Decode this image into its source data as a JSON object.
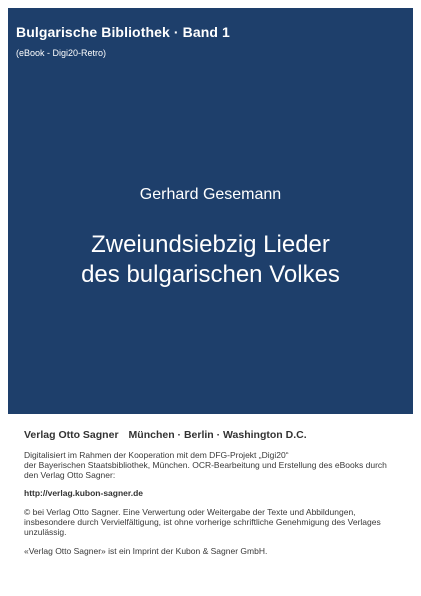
{
  "cover": {
    "series": "Bulgarische Bibliothek · Band 1",
    "series_note": "(eBook - Digi20-Retro)",
    "author": "Gerhard Gesemann",
    "title_lines": [
      "Zweiundsiebzig Lieder",
      "des bulgarischen Volkes"
    ],
    "background_color": "#1e3f6b"
  },
  "footer": {
    "publisher": "Verlag Otto Sagner",
    "cities": "München · Berlin · Washington D.C.",
    "digitised_lines": [
      "Digitalisiert im Rahmen der Kooperation mit dem DFG-Projekt „Digi20“",
      "der Bayerischen Staatsbibliothek, München. OCR-Bearbeitung und Erstellung des eBooks durch",
      "den Verlag Otto Sagner:"
    ],
    "url": "http://verlag.kubon-sagner.de",
    "copyright_lines": [
      "© bei Verlag Otto Sagner. Eine Verwertung oder Weitergabe der Texte und Abbildungen,",
      "insbesondere durch Vervielfältigung, ist ohne vorherige schriftliche Genehmigung des Verlages",
      "unzulässig."
    ],
    "imprint": "«Verlag Otto Sagner» ist ein Imprint der Kubon & Sagner GmbH."
  }
}
